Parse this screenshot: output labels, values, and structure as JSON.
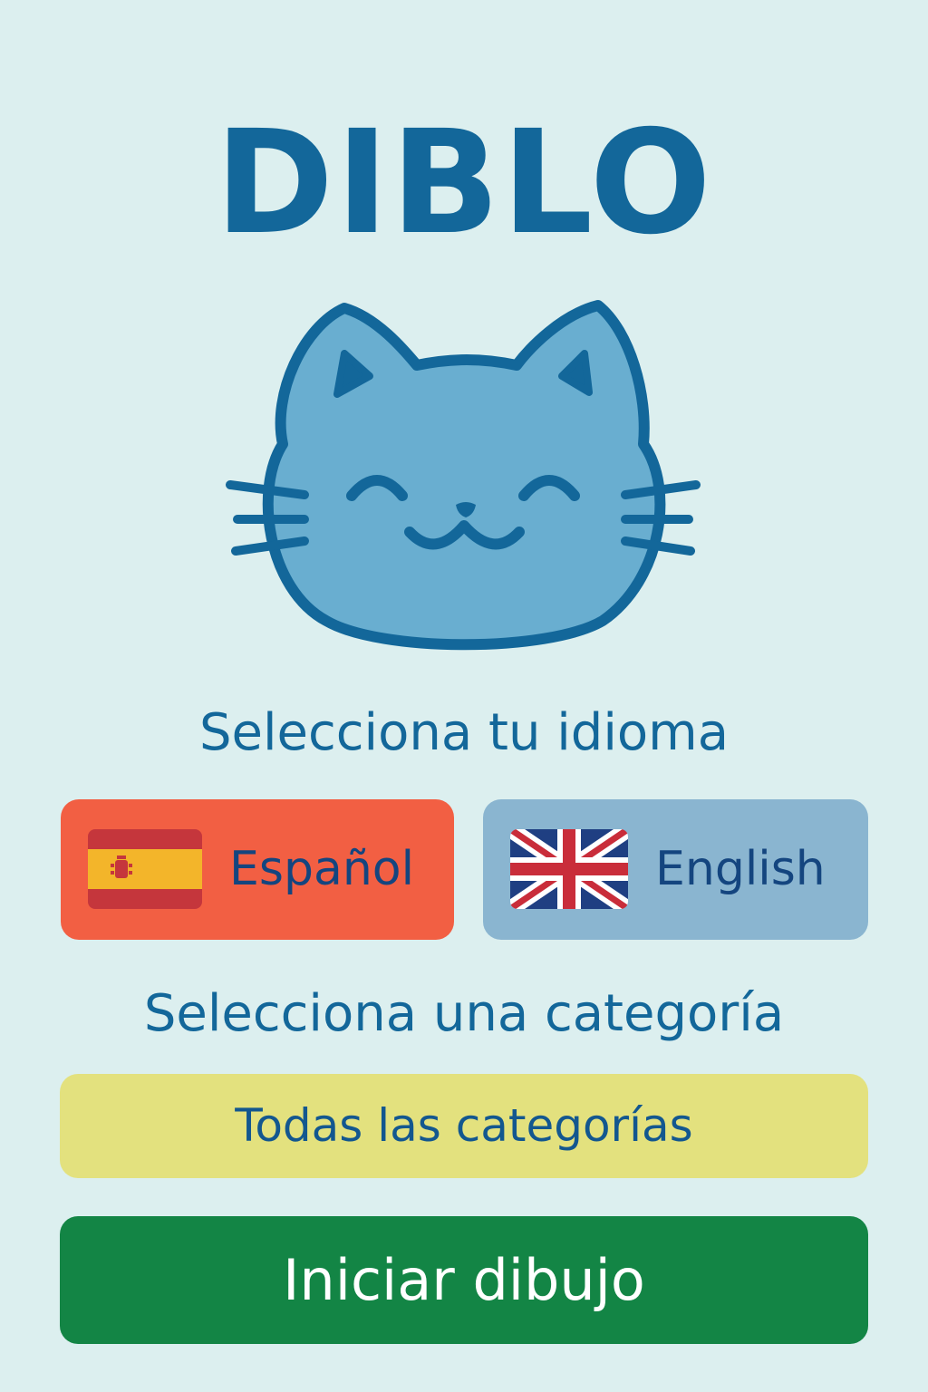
{
  "app": {
    "title": "DIBLO"
  },
  "language": {
    "heading": "Selecciona tu idioma",
    "options": [
      {
        "label": "Español",
        "flag_icon": "spain-flag-icon",
        "color": "#f25f43"
      },
      {
        "label": "English",
        "flag_icon": "uk-flag-icon",
        "color": "#8ab5d0"
      }
    ]
  },
  "category": {
    "heading": "Selecciona una categoría",
    "selected": "Todas las categorías",
    "color": "#e3e17e"
  },
  "actions": {
    "start_label": "Iniciar dibujo",
    "start_color": "#138545"
  },
  "mascot": {
    "icon": "cat-face-icon"
  },
  "theme": {
    "background": "#dcefef",
    "primary": "#13679a"
  }
}
